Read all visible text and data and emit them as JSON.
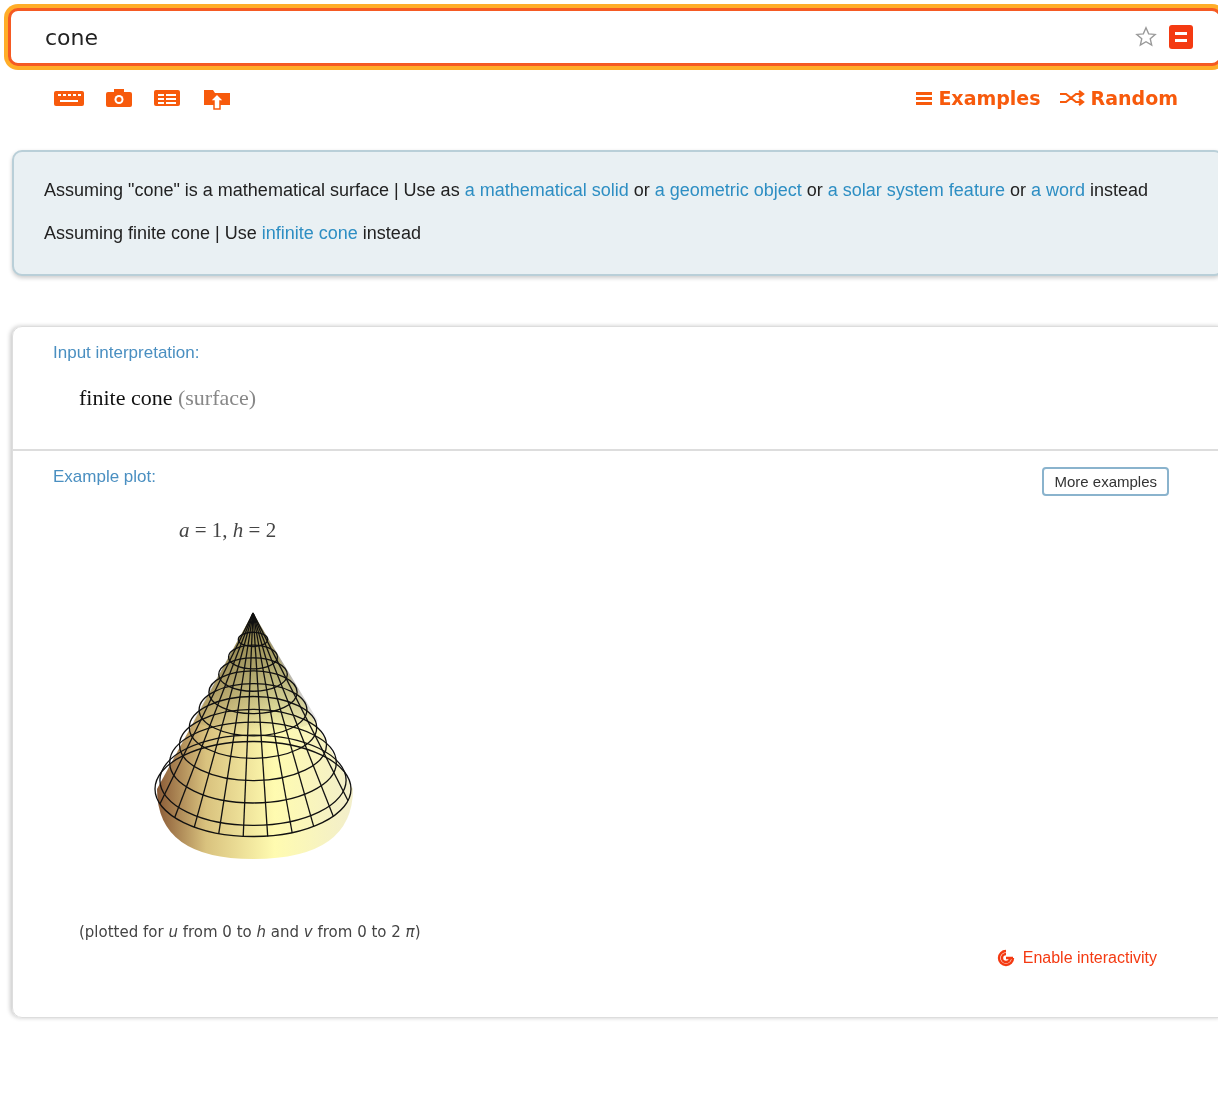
{
  "search": {
    "value": "cone"
  },
  "toolbar": {
    "links": [
      {
        "kind": "examples",
        "label": "Examples"
      },
      {
        "kind": "random",
        "label": "Random"
      }
    ]
  },
  "assumptions": [
    [
      {
        "kind": "text",
        "text": "Assuming \"cone\" is a mathematical surface | Use as "
      },
      {
        "kind": "link",
        "text": "a mathematical solid"
      },
      {
        "kind": "text",
        "text": " or "
      },
      {
        "kind": "link",
        "text": "a geometric object"
      },
      {
        "kind": "text",
        "text": " or "
      },
      {
        "kind": "link",
        "text": "a solar system feature"
      },
      {
        "kind": "text",
        "text": " or "
      },
      {
        "kind": "link",
        "text": "a word"
      },
      {
        "kind": "text",
        "text": " instead"
      }
    ],
    [
      {
        "kind": "text",
        "text": "Assuming finite cone | Use "
      },
      {
        "kind": "link",
        "text": "infinite cone"
      },
      {
        "kind": "text",
        "text": " instead"
      }
    ]
  ],
  "pods": [
    {
      "kind": "interpretation",
      "title": "Input interpretation:",
      "main": "finite cone",
      "note": "(surface)"
    },
    {
      "kind": "plot",
      "title": "Example plot:",
      "button": "More examples",
      "params": "*a* = 1, *h* = 2",
      "caption": "(plotted for *u* from 0 to *h* and *v* from 0 to 2 *π*)",
      "action": "Enable interactivity"
    }
  ]
}
